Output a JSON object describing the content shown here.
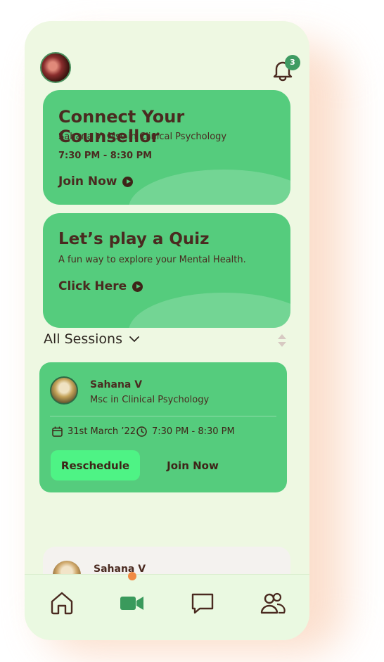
{
  "header": {
    "notification_count": "3"
  },
  "cards": {
    "counsellor": {
      "title": "Connect Your Counsellor",
      "subtitle": "Sahana V, Msc in Clinical Psychology",
      "time": "7:30 PM - 8:30 PM",
      "cta": "Join Now"
    },
    "quiz": {
      "title": "Let’s play a Quiz",
      "subtitle": "A fun way to explore your Mental Health.",
      "cta": "Click Here"
    }
  },
  "sessions": {
    "heading": "All Sessions",
    "items": [
      {
        "name": "Sahana V",
        "degree": "Msc in Clinical Psychology",
        "date": "31st March ’22",
        "time": "7:30 PM - 8:30 PM",
        "reschedule_label": "Reschedule",
        "join_label": "Join Now"
      },
      {
        "name": "Sahana V"
      }
    ]
  },
  "nav": {
    "items": [
      "home-icon",
      "video-icon",
      "chat-icon",
      "community-icon"
    ],
    "active": "video-icon"
  },
  "colors": {
    "background": "#eef8e2",
    "card": "#55cc7d",
    "primary_button": "#4ef385",
    "text": "#4a2a20",
    "accent": "#f08a43",
    "badge": "#3e9b62"
  }
}
